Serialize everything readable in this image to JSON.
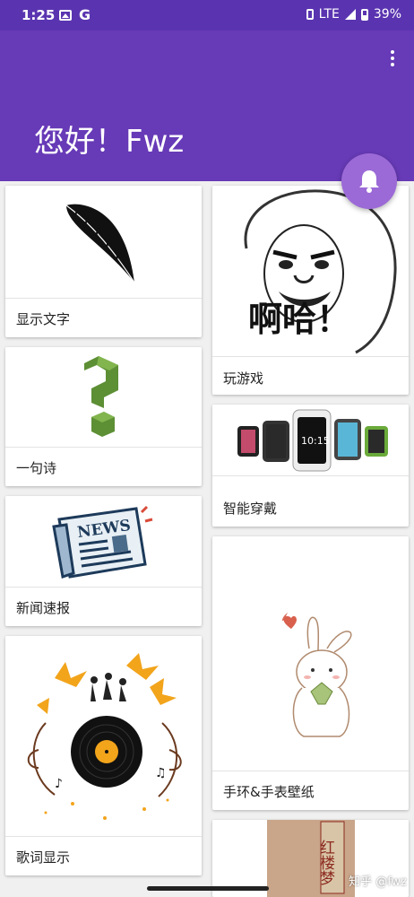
{
  "status_bar": {
    "time": "1:25",
    "network": "LTE",
    "battery": "39%"
  },
  "app_bar": {
    "title": "您好！Fwz"
  },
  "cards": {
    "display_text": {
      "label": "显示文字",
      "image": "feather-icon"
    },
    "play_game": {
      "label": "玩游戏",
      "image": "meme-face",
      "meme_text": "啊哈！"
    },
    "one_poem": {
      "label": "一句诗",
      "image": "question-mark-icon"
    },
    "smart_wear": {
      "label": "智能穿戴",
      "image": "smartwatch-icon",
      "watch_time": "10:15"
    },
    "news": {
      "label": "新闻速报",
      "image": "newspaper-icon",
      "news_text": "NEWS"
    },
    "wallpaper": {
      "label": "手环&手表壁纸",
      "image": "rabbit-illustration"
    },
    "lyrics": {
      "label": "歌词显示",
      "image": "vinyl-record-icon"
    },
    "book": {
      "image": "book-cover",
      "book_text": "红楼梦"
    }
  },
  "watermark": "知乎 @fwz"
}
